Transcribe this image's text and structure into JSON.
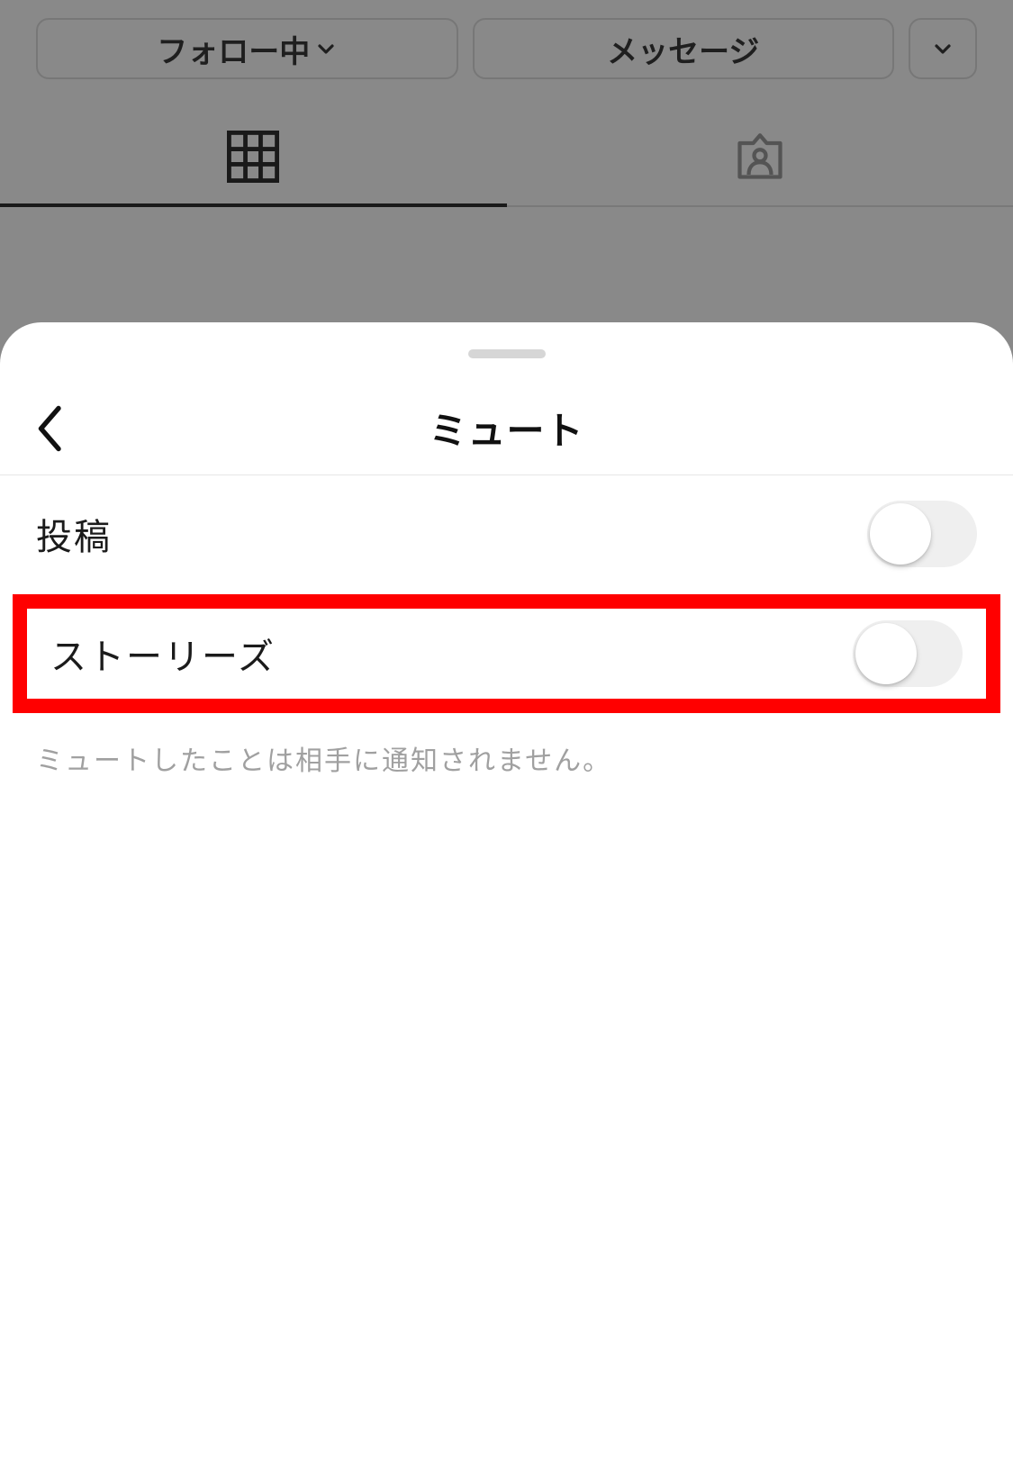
{
  "profile": {
    "following_label": "フォロー中",
    "message_label": "メッセージ"
  },
  "sheet": {
    "title": "ミュート",
    "rows": {
      "posts": {
        "label": "投稿",
        "on": false
      },
      "stories": {
        "label": "ストーリーズ",
        "on": false
      }
    },
    "note": "ミュートしたことは相手に通知されません。"
  },
  "highlight": {
    "target": "stories",
    "color": "#ff0000"
  }
}
